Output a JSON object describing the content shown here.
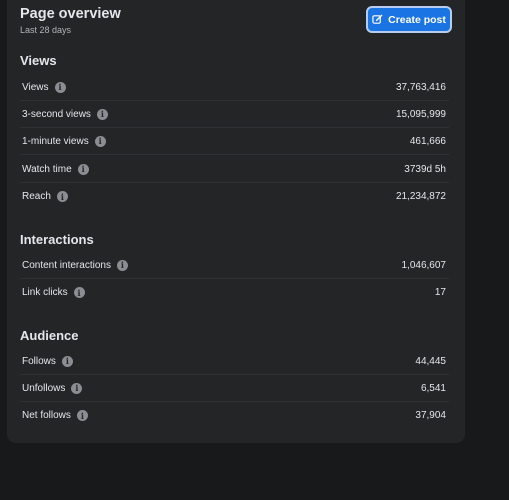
{
  "header": {
    "title": "Page overview",
    "subtitle": "Last 28 days",
    "create_post_label": "Create post"
  },
  "sections": [
    {
      "title": "Views",
      "rows": [
        {
          "label": "Views",
          "value": "37,763,416"
        },
        {
          "label": "3-second views",
          "value": "15,095,999"
        },
        {
          "label": "1-minute views",
          "value": "461,666"
        },
        {
          "label": "Watch time",
          "value": "3739d 5h"
        },
        {
          "label": "Reach",
          "value": "21,234,872"
        }
      ]
    },
    {
      "title": "Interactions",
      "rows": [
        {
          "label": "Content interactions",
          "value": "1,046,607"
        },
        {
          "label": "Link clicks",
          "value": "17"
        }
      ]
    },
    {
      "title": "Audience",
      "rows": [
        {
          "label": "Follows",
          "value": "44,445"
        },
        {
          "label": "Unfollows",
          "value": "6,541"
        },
        {
          "label": "Net follows",
          "value": "37,904"
        }
      ]
    }
  ],
  "icons": {
    "info": "info-icon",
    "create_post": "edit-icon"
  },
  "colors": {
    "accent": "#1b74e4",
    "card_background": "#242527",
    "page_background": "#18191b"
  }
}
